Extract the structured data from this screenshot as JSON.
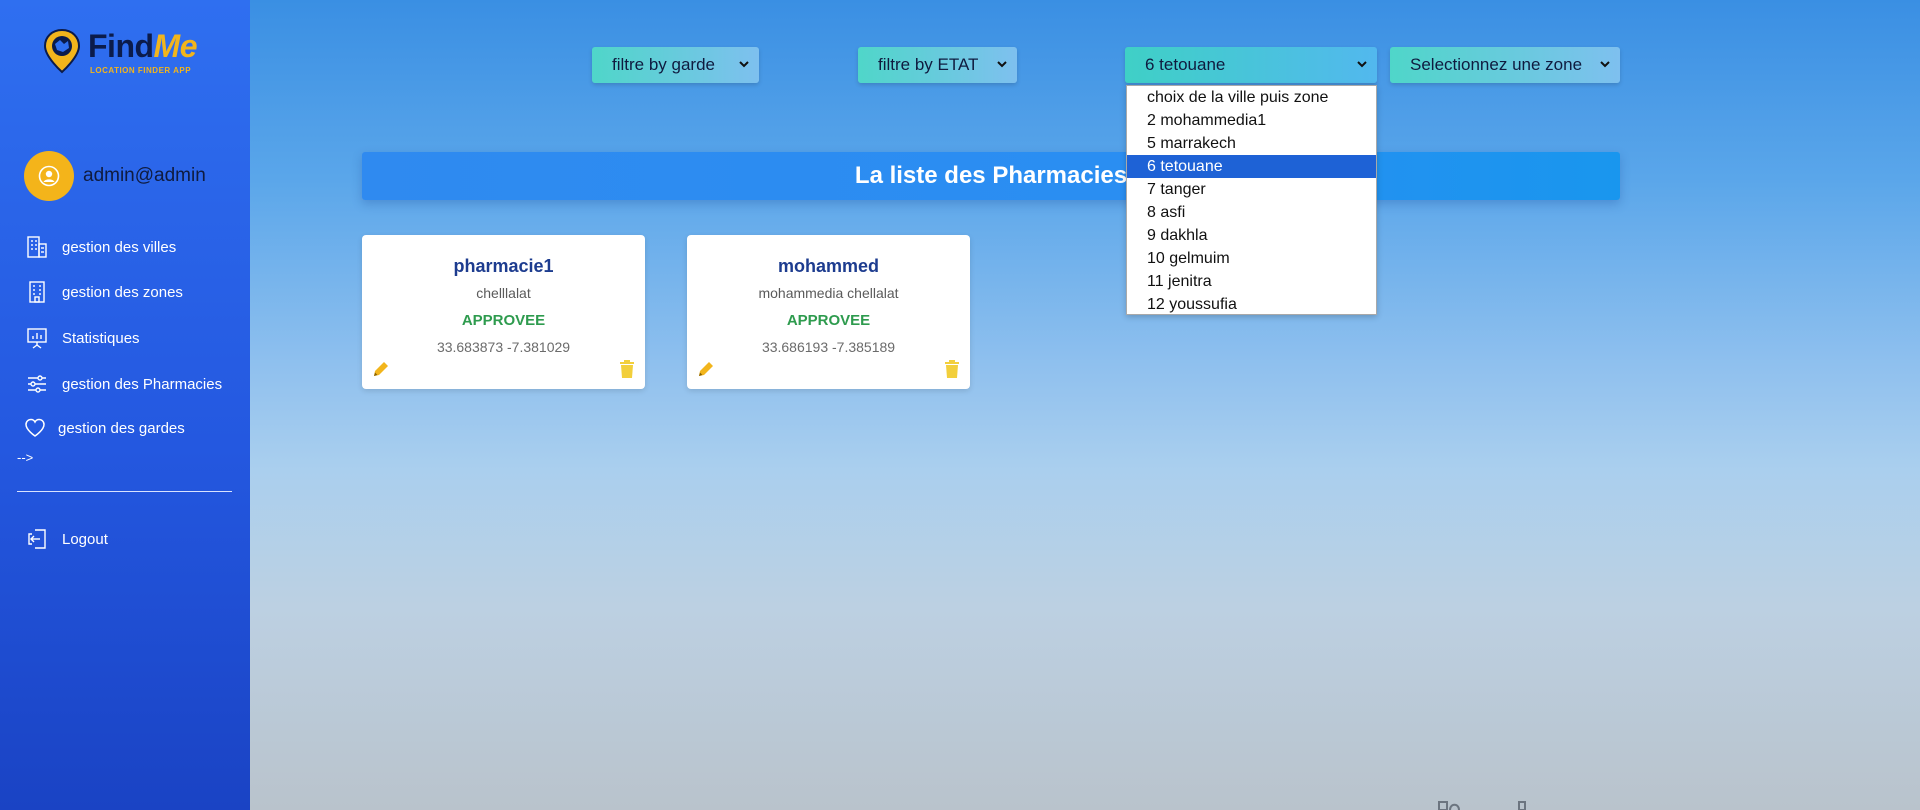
{
  "brand": {
    "name_part1": "Find",
    "name_part2": "Me",
    "tagline": "LOCATION FINDER APP",
    "accent": "#f2b51c"
  },
  "sidebar": {
    "user": "admin@admin",
    "items": [
      {
        "label": "gestion des villes",
        "icon": "city-buildings-icon"
      },
      {
        "label": "gestion des zones",
        "icon": "building-icon"
      },
      {
        "label": "Statistiques",
        "icon": "presentation-chart-icon"
      },
      {
        "label": "gestion des Pharmacies",
        "icon": "sliders-icon"
      },
      {
        "label": "gestion des gardes",
        "icon": "heart-icon"
      }
    ],
    "stray_text": "-->",
    "logout": "Logout"
  },
  "filters": {
    "garde": "filtre by garde",
    "etat": "filtre by ETAT",
    "ville": "6 tetouane",
    "zone": "Selectionnez une zone"
  },
  "ville_dropdown": {
    "options": [
      "choix de la ville puis zone",
      "2 mohammedia1",
      "5 marrakech",
      "6 tetouane",
      "7 tanger",
      "8 asfi",
      "9 dakhla",
      "10 gelmuim",
      "11 jenitra",
      "12 youssufia"
    ],
    "selected_index": 3
  },
  "banner": {
    "title": "La liste des Pharmacies"
  },
  "pharmacies": [
    {
      "name": "pharmacie1",
      "address": "chelllalat",
      "status": "APPROVEE",
      "coords": "33.683873 -7.381029"
    },
    {
      "name": "mohammed",
      "address": "mohammedia chellalat",
      "status": "APPROVEE",
      "coords": "33.686193 -7.385189"
    }
  ],
  "colors": {
    "status_approved": "#2e9b4e",
    "action_icons": "#f2b51c",
    "selected_option": "#1e62d6"
  }
}
